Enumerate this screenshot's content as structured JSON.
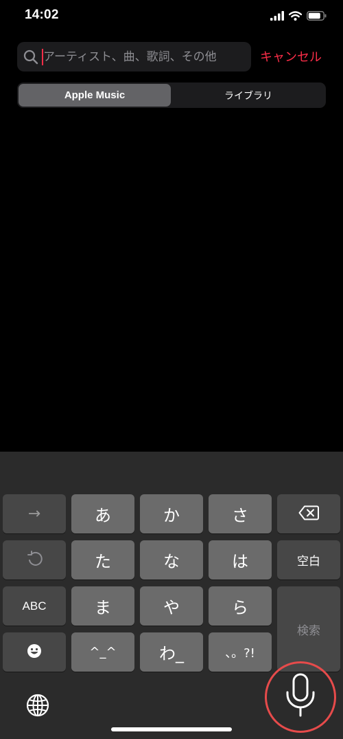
{
  "status_bar": {
    "time": "14:02"
  },
  "search": {
    "placeholder": "アーティスト、曲、歌詞、その他",
    "value": "",
    "cancel_label": "キャンセル"
  },
  "segments": {
    "selected_label": "Apple Music",
    "other_label": "ライブラリ"
  },
  "keyboard": {
    "row1": {
      "arrow_label": "→",
      "a": "あ",
      "ka": "か",
      "sa": "さ"
    },
    "row2": {
      "ta": "た",
      "na": "な",
      "ha": "は",
      "space": "空白"
    },
    "row3": {
      "abc": "ABC",
      "ma": "ま",
      "ya": "や",
      "ra": "ら",
      "search": "検索"
    },
    "row4": {
      "kaomoji": "^_^",
      "wa": "わ_",
      "punct": "、。?!"
    }
  },
  "colors": {
    "accent": "#fa2d48",
    "background": "#000000",
    "field_bg": "#1c1c1e",
    "keyboard_bg": "#2b2b2b",
    "char_key": "#6b6b6b",
    "function_key": "#474747",
    "mic_ring": "#e64b4b"
  },
  "icons": {
    "signal": "cellular-signal-icon",
    "wifi": "wifi-icon",
    "battery": "battery-icon",
    "search": "magnifying-glass-icon",
    "backspace": "delete-backward-icon",
    "undo": "undo-icon",
    "emoji": "smiley-icon",
    "globe": "globe-icon",
    "mic": "microphone-icon"
  }
}
